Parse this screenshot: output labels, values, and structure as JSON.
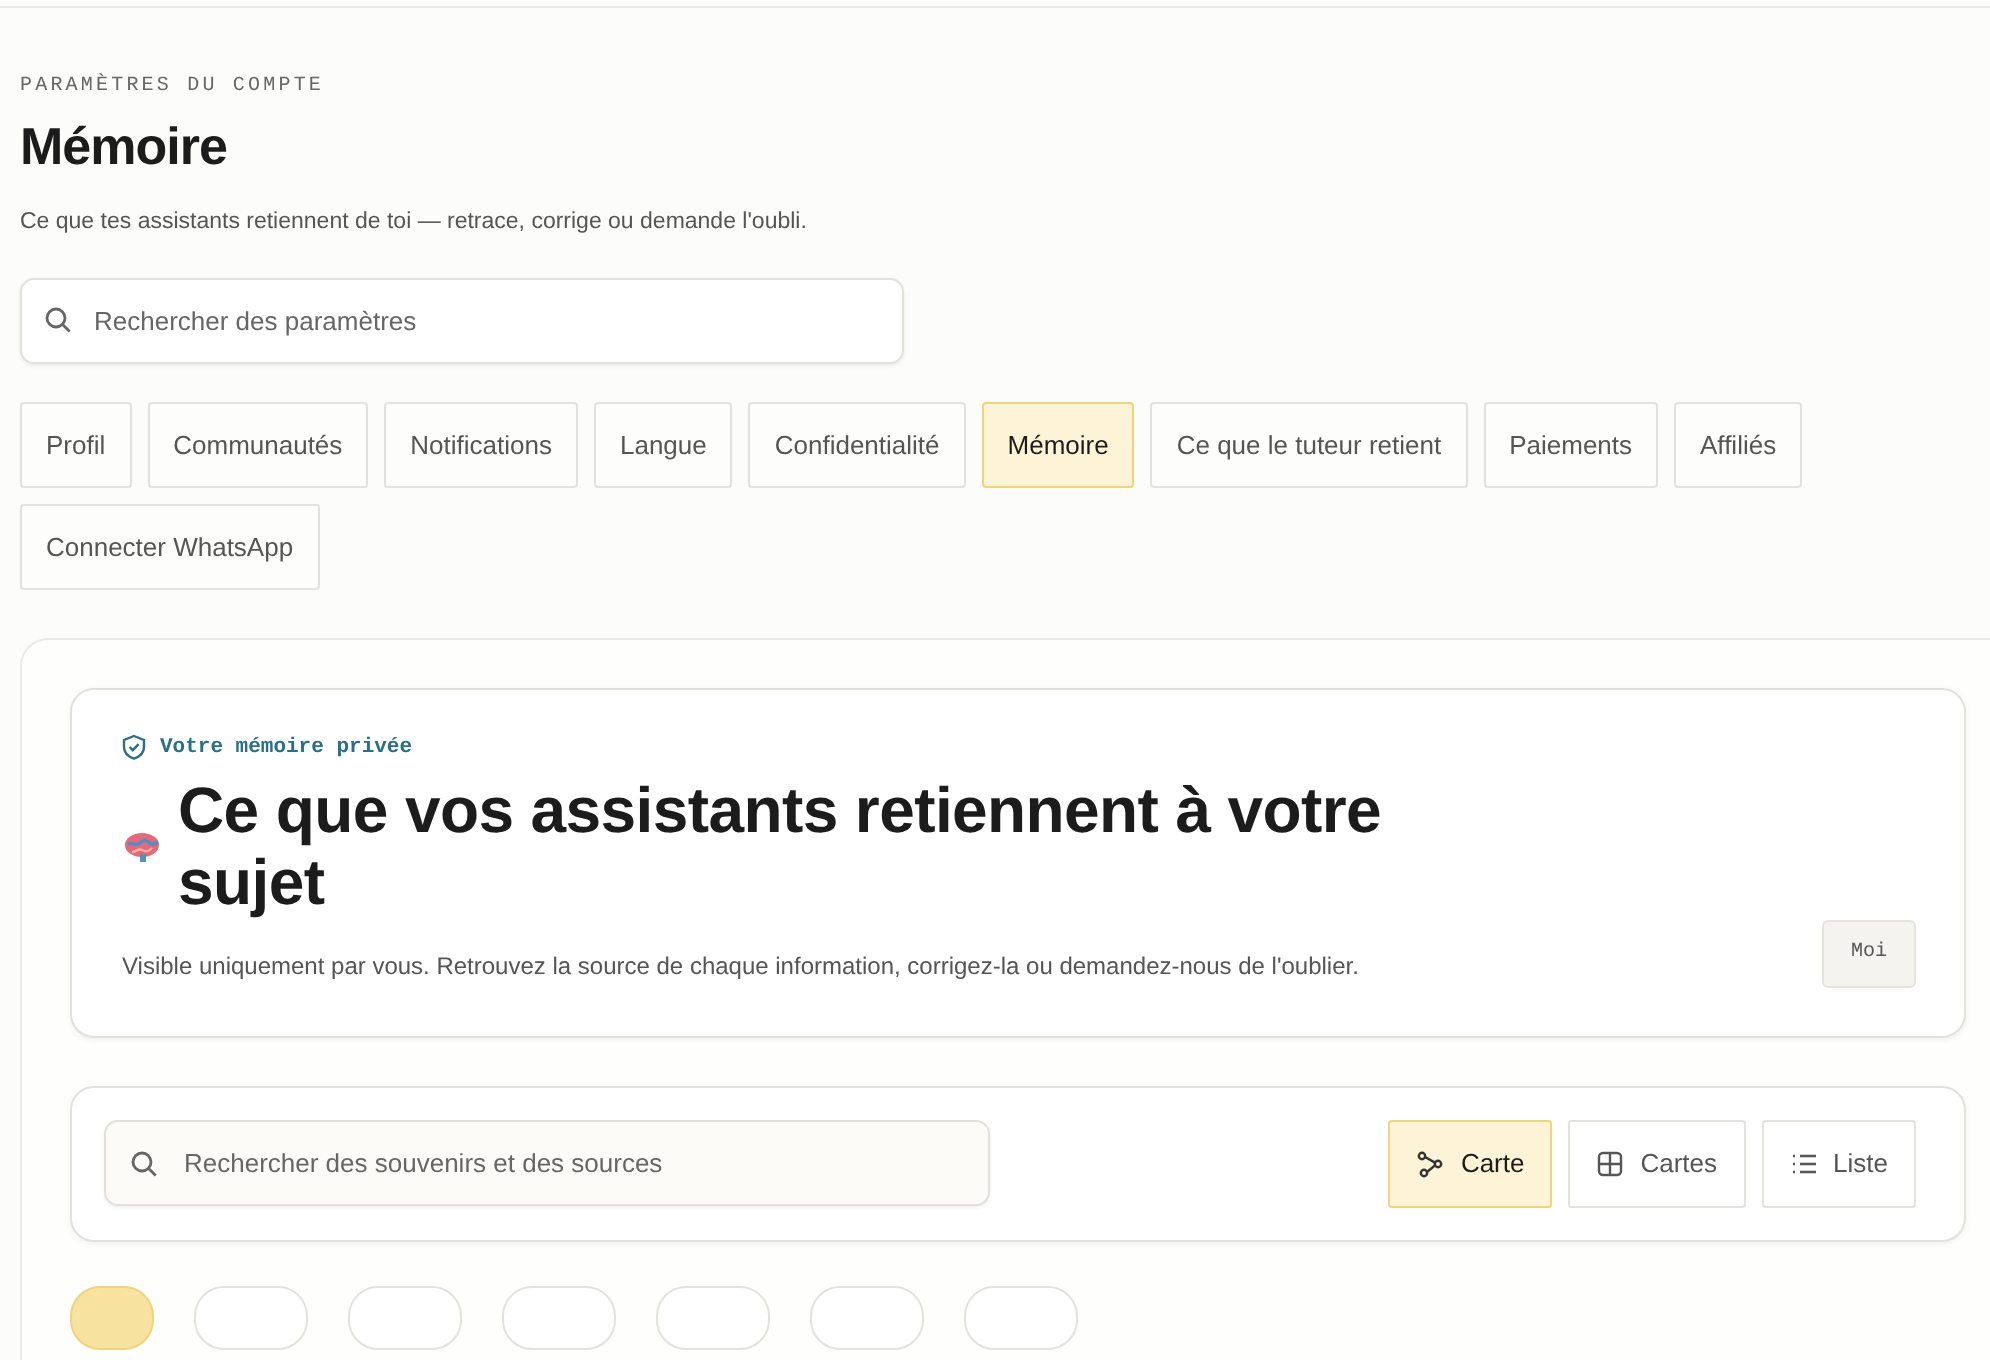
{
  "section_label": "PARAMÈTRES DU COMPTE",
  "title": "Mémoire",
  "subtitle": "Ce que tes assistants retiennent de toi — retrace, corrige ou demande l'oubli.",
  "search": {
    "placeholder": "Rechercher des paramètres"
  },
  "tabs": [
    {
      "label": "Profil",
      "selected": false
    },
    {
      "label": "Communautés",
      "selected": false
    },
    {
      "label": "Notifications",
      "selected": false
    },
    {
      "label": "Langue",
      "selected": false
    },
    {
      "label": "Confidentialité",
      "selected": false
    },
    {
      "label": "Mémoire",
      "selected": true
    },
    {
      "label": "Ce que le tuteur retient",
      "selected": false
    },
    {
      "label": "Paiements",
      "selected": false
    },
    {
      "label": "Affiliés",
      "selected": false
    },
    {
      "label": "Connecter WhatsApp",
      "selected": false
    }
  ],
  "hero": {
    "eyebrow": "Votre mémoire privée",
    "title": "Ce que vos assistants retiennent à votre sujet",
    "description": "Visible uniquement par vous. Retrouvez la source de chaque information, corrigez-la ou demandez-nous de l'oublier.",
    "badge": "Moi"
  },
  "toolbar": {
    "search": {
      "placeholder": "Rechercher des souvenirs et des sources"
    },
    "views": [
      {
        "label": "Carte",
        "kind": "map",
        "selected": true
      },
      {
        "label": "Cartes",
        "kind": "cards",
        "selected": false
      },
      {
        "label": "Liste",
        "kind": "list",
        "selected": false
      }
    ]
  },
  "chips": [
    {
      "selected": true
    },
    {
      "selected": false
    },
    {
      "selected": false
    },
    {
      "selected": false
    },
    {
      "selected": false
    },
    {
      "selected": false
    },
    {
      "selected": false
    }
  ]
}
